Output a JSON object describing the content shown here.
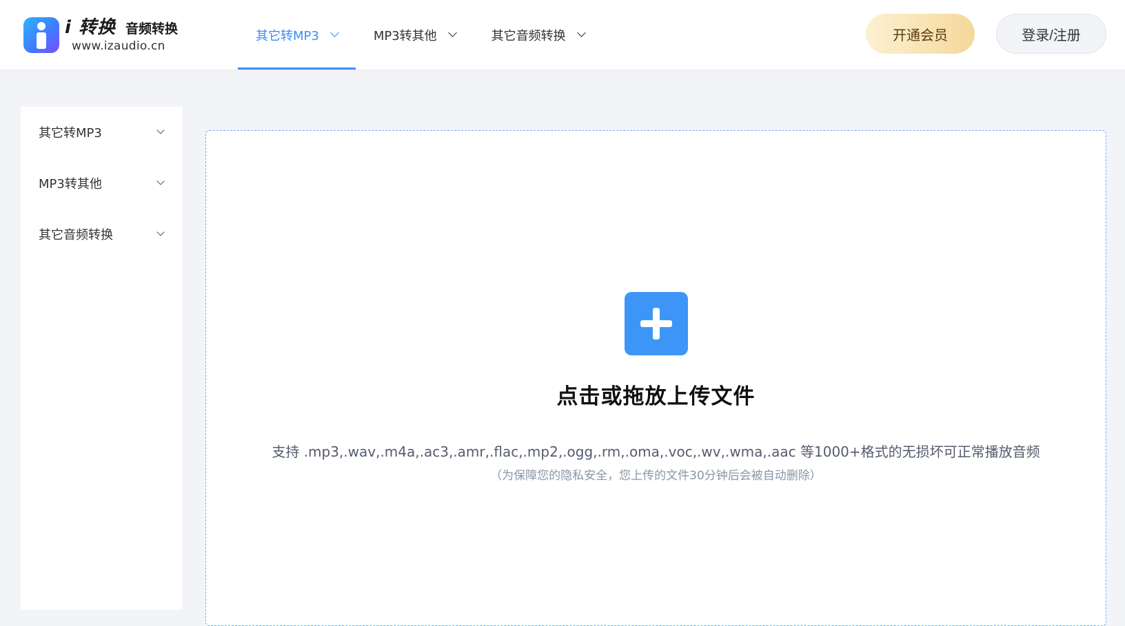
{
  "header": {
    "logo": {
      "brand": "i 转换",
      "subtitle": "音频转换",
      "url": "www.izaudio.cn"
    },
    "nav": [
      {
        "label": "其它转MP3",
        "active": true
      },
      {
        "label": "MP3转其他",
        "active": false
      },
      {
        "label": "其它音频转换",
        "active": false
      }
    ],
    "vip_button": "开通会员",
    "login_button": "登录/注册"
  },
  "sidebar": {
    "items": [
      {
        "label": "其它转MP3"
      },
      {
        "label": "MP3转其他"
      },
      {
        "label": "其它音频转换"
      }
    ]
  },
  "upload": {
    "title": "点击或拖放上传文件",
    "formats": "支持 .mp3,.wav,.m4a,.ac3,.amr,.flac,.mp2,.ogg,.rm,.oma,.voc,.wv,.wma,.aac 等1000+格式的无损坏可正常播放音频",
    "note": "（为保障您的隐私安全，您上传的文件30分钟后会被自动删除）"
  },
  "colors": {
    "accent": "#3a8ef6",
    "upload_button": "#3d96f7",
    "vip_gradient_start": "#fdf1d2",
    "vip_gradient_end": "#f4d89a",
    "page_background": "#f3f4f8"
  },
  "icons": {
    "logo": "izaudio-logo-icon",
    "dropdown": "chevron-down-icon",
    "upload": "plus-icon"
  }
}
